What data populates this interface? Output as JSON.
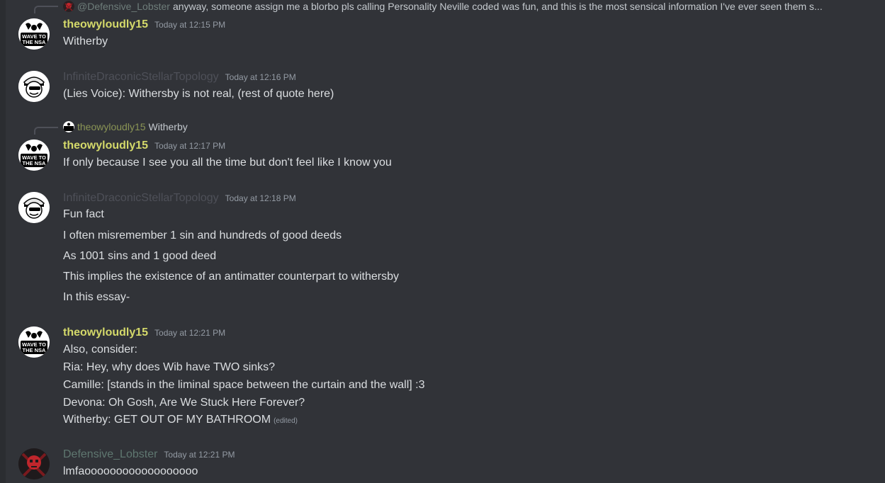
{
  "colors": {
    "background": "#313338",
    "text": "#dbdee1",
    "muted": "#949ba4",
    "theowyloudly15": "#d4d96a",
    "infinite": "#4e5058",
    "defensive": "#5f7770",
    "reply_defensive": "#6e7d7a",
    "reply_theowy": "#8a9455"
  },
  "reply_top": {
    "author": "@Defensive_Lobster",
    "text": "anyway, someone assign me a blorbo pls calling Personality Neville coded was fun, and this is the most sensical information I've ever seen them s..."
  },
  "avatars": {
    "nsa_badge_top": "WAVE TO",
    "nsa_badge_bottom": "THE NSA"
  },
  "messages": [
    {
      "author": "theowyloudly15",
      "timestamp": "Today at 12:15 PM",
      "lines": [
        "Witherby"
      ]
    },
    {
      "author": "InfiniteDraconicStellarTopology",
      "timestamp": "Today at 12:16 PM",
      "lines": [
        "(Lies Voice): Withersby is not real, (rest of quote here)"
      ]
    },
    {
      "reply": {
        "author": "theowyloudly15",
        "text": "Witherby"
      },
      "author": "theowyloudly15",
      "timestamp": "Today at 12:17 PM",
      "lines": [
        "If only because I see you all the time but don't feel like I know you"
      ]
    },
    {
      "author": "InfiniteDraconicStellarTopology",
      "timestamp": "Today at 12:18 PM",
      "lines": [
        "Fun fact",
        "I often misremember 1 sin and hundreds of good deeds",
        "As 1001 sins and 1 good deed",
        "This implies the existence of an antimatter counterpart to withersby",
        "In this essay-"
      ]
    },
    {
      "author": "theowyloudly15",
      "timestamp": "Today at 12:21 PM",
      "lines": [
        "Also, consider:",
        "Ria: Hey, why does Wib have TWO sinks?",
        "Camille: [stands in the liminal space between the curtain and the wall] :3",
        "Devona: Oh Gosh, Are We Stuck Here Forever?",
        "Witherby: GET OUT OF MY BATHROOM"
      ],
      "edited": "(edited)"
    },
    {
      "author": "Defensive_Lobster",
      "timestamp": "Today at 12:21 PM",
      "lines": [
        "lmfaoooooooooooooooooo"
      ]
    }
  ]
}
